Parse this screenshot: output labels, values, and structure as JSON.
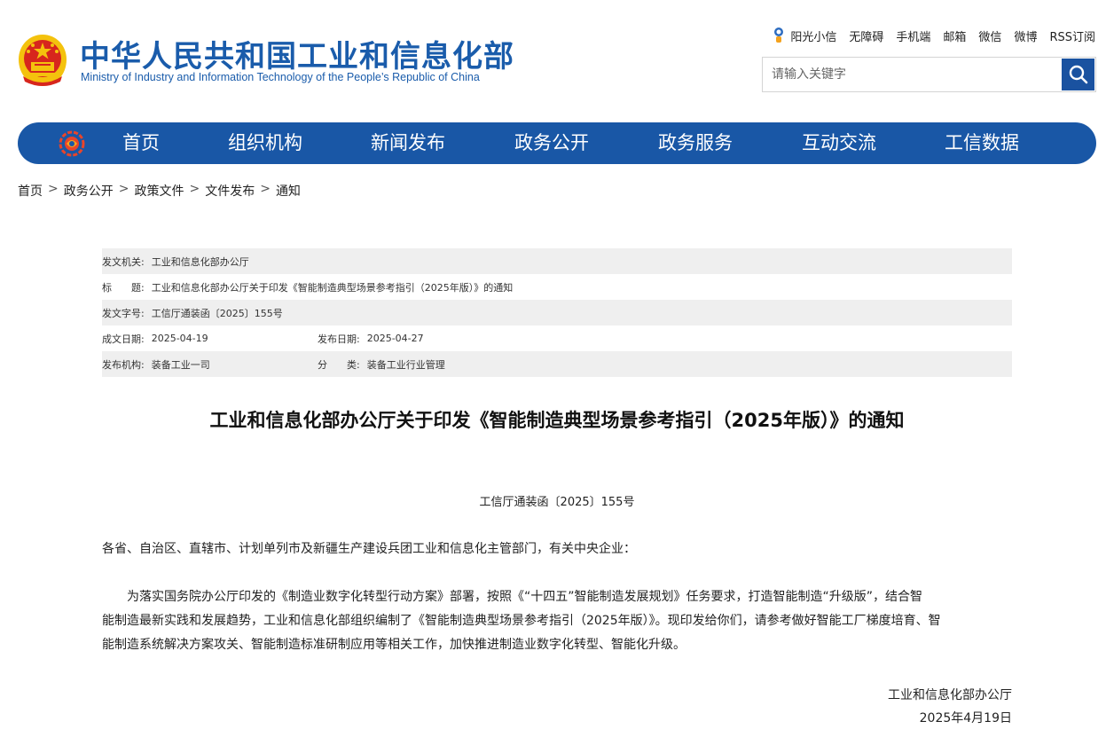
{
  "header": {
    "title_cn": "中华人民共和国工业和信息化部",
    "title_en": "Ministry of Industry and Information Technology of the People’s Republic of China",
    "top_links": [
      "阳光小信",
      "无障碍",
      "手机端",
      "邮箱",
      "微信",
      "微博",
      "RSS订阅"
    ],
    "search_placeholder": "请输入关键字"
  },
  "nav": {
    "items": [
      "首页",
      "组织机构",
      "新闻发布",
      "政务公开",
      "政务服务",
      "互动交流",
      "工信数据"
    ]
  },
  "breadcrumb": [
    "首页",
    "政务公开",
    "政策文件",
    "文件发布",
    "通知"
  ],
  "breadcrumb_sep": ">",
  "meta": {
    "issuer_label": "发文机关:",
    "issuer": "工业和信息化部办公厅",
    "title_label": "标　　题:",
    "title": "工业和信息化部办公厅关于印发《智能制造典型场景参考指引（2025年版）》的通知",
    "docno_label": "发文字号:",
    "docno": "工信厅通装函〔2025〕155号",
    "created_label": "成文日期:",
    "created": "2025-04-19",
    "published_label": "发布日期:",
    "published": "2025-04-27",
    "org_label": "发布机构:",
    "org": "装备工业一司",
    "category_label": "分　　类:",
    "category": "装备工业行业管理"
  },
  "article": {
    "title": "工业和信息化部办公厅关于印发《智能制造典型场景参考指引（2025年版）》的通知",
    "doc_no": "工信厅通装函〔2025〕155号",
    "salutation": "各省、自治区、直辖市、计划单列市及新疆生产建设兵团工业和信息化主管部门，有关中央企业：",
    "body_lines": [
      "　　为落实国务院办公厅印发的《制造业数字化转型行动方案》部署，按照《“十四五”智能制造发展规划》任务要求，打造智能制造“升级版”，结合智",
      "能制造最新实践和发展趋势，工业和信息化部组织编制了《智能制造典型场景参考指引（2025年版）》。现印发给你们，请参考做好智能工厂梯度培育、智",
      "能制造系统解决方案攻关、智能制造标准研制应用等相关工作，加快推进制造业数字化转型、智能化升级。"
    ],
    "signature_org": "工业和信息化部办公厅",
    "signature_date": "2025年4月19日"
  },
  "colors": {
    "brand_blue": "#1a5cab",
    "nav_blue": "#1957a6",
    "emblem_red": "#d7261d",
    "emblem_gold": "#f4c20d"
  }
}
